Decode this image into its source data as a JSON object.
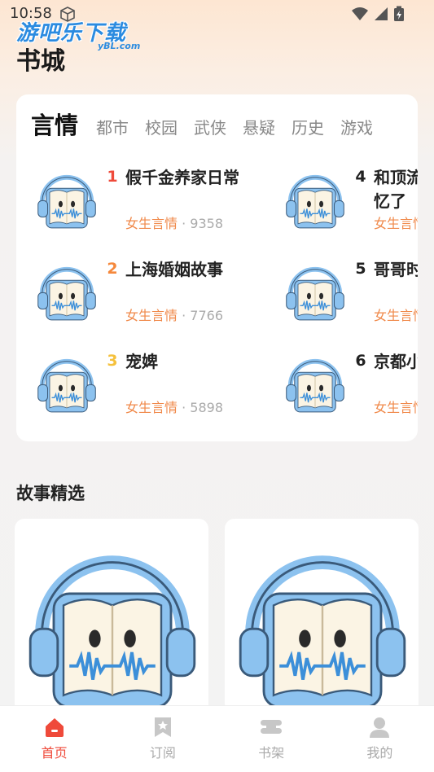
{
  "status": {
    "time": "10:58"
  },
  "watermark": {
    "main": "游吧乐下载",
    "sub": "yBL.com"
  },
  "page_title": "书城",
  "tabs": {
    "active": "言情",
    "items": [
      "都市",
      "校园",
      "武侠",
      "悬疑",
      "历史",
      "游戏"
    ]
  },
  "books": [
    {
      "rank": "1",
      "title": "假千金养家日常",
      "category": "女生言情",
      "sep": " · ",
      "count": "9358",
      "rank_color": "#ef4a3a"
    },
    {
      "rank": "2",
      "title": "上海婚姻故事",
      "category": "女生言情",
      "sep": " · ",
      "count": "7766",
      "rank_color": "#f5883c"
    },
    {
      "rank": "3",
      "title": "宠婢",
      "category": "女生言情",
      "sep": " · ",
      "count": "5898",
      "rank_color": "#f5c13c"
    },
    {
      "rank": "4",
      "title": "和顶流…忆了",
      "title_display": "和顶流\n忆了",
      "category": "女生言情",
      "sep": "",
      "count": "",
      "rank_color": "#222222"
    },
    {
      "rank": "5",
      "title": "哥哥时",
      "category": "女生言情",
      "sep": "",
      "count": "",
      "rank_color": "#222222"
    },
    {
      "rank": "6",
      "title": "京都小",
      "category": "女生言情",
      "sep": "",
      "count": "",
      "rank_color": "#222222"
    }
  ],
  "section": {
    "title": "故事精选"
  },
  "nav": [
    {
      "label": "首页",
      "icon": "home-icon",
      "active": true
    },
    {
      "label": "订阅",
      "icon": "bookmark-star-icon",
      "active": false
    },
    {
      "label": "书架",
      "icon": "bookshelf-icon",
      "active": false
    },
    {
      "label": "我的",
      "icon": "person-icon",
      "active": false
    }
  ],
  "colors": {
    "accent": "#ef4a3a",
    "category": "#f0894a",
    "cover_blue": "#7cb8ec"
  }
}
